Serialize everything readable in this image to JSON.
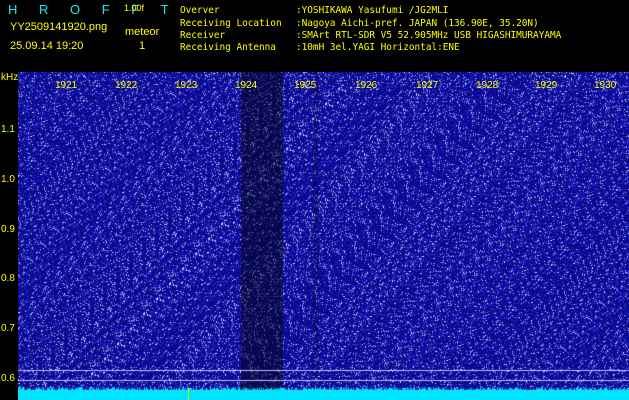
{
  "header": {
    "app_title": "H R O F F T",
    "version": "1.00f",
    "filename": "YY2509141920.png",
    "mode": "meteor",
    "datetime": "25.09.14 19:20",
    "count": "1"
  },
  "info": [
    {
      "key": "Overver",
      "value": ":YOSHIKAWA Yasufumi /JG2MLI"
    },
    {
      "key": "Receiving Location",
      "value": ":Nagoya Aichi-pref. JAPAN (136.90E, 35.20N)"
    },
    {
      "key": "Receiver",
      "value": ":SMArt RTL-SDR V5 52.905MHz USB HIGASHIMURAYAMA"
    },
    {
      "key": "Receiving Antenna",
      "value": ":10mH 3el.YAGI Horizontal:ENE"
    }
  ],
  "spectrogram": {
    "unit": "kHz",
    "y_ticks": [
      "1.1",
      "1.0",
      "0.9",
      "0.8",
      "0.7",
      "0.6"
    ],
    "x_ticks": [
      "1921",
      "1922",
      "1923",
      "1924",
      "1925",
      "1926",
      "1927",
      "1928",
      "1929",
      "1930"
    ],
    "colors": {
      "background": "#1a1aa0",
      "noise": "#c8c8ff",
      "baseline": "#00e5ff",
      "label": "#ffff00"
    }
  }
}
